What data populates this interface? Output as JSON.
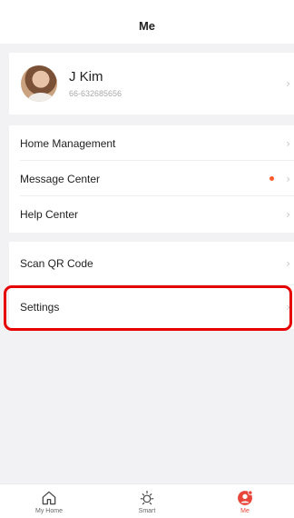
{
  "header": {
    "title": "Me"
  },
  "profile": {
    "name": "J Kim",
    "phone": "66-632685656"
  },
  "menu_group_1": [
    {
      "label": "Home Management",
      "has_badge": false
    },
    {
      "label": "Message Center",
      "has_badge": true
    },
    {
      "label": "Help Center",
      "has_badge": false
    }
  ],
  "menu_group_2": [
    {
      "label": "Scan QR Code"
    },
    {
      "label": "Settings"
    }
  ],
  "chevron": "›",
  "tabs": [
    {
      "label": "My Home",
      "icon": "house-icon",
      "active": false
    },
    {
      "label": "Smart",
      "icon": "sun-icon",
      "active": false
    },
    {
      "label": "Me",
      "icon": "person-icon",
      "active": true
    }
  ],
  "colors": {
    "accent": "#e8463a",
    "badge": "#ff5a2a",
    "highlight": "#e60000",
    "background": "#f2f2f4"
  }
}
